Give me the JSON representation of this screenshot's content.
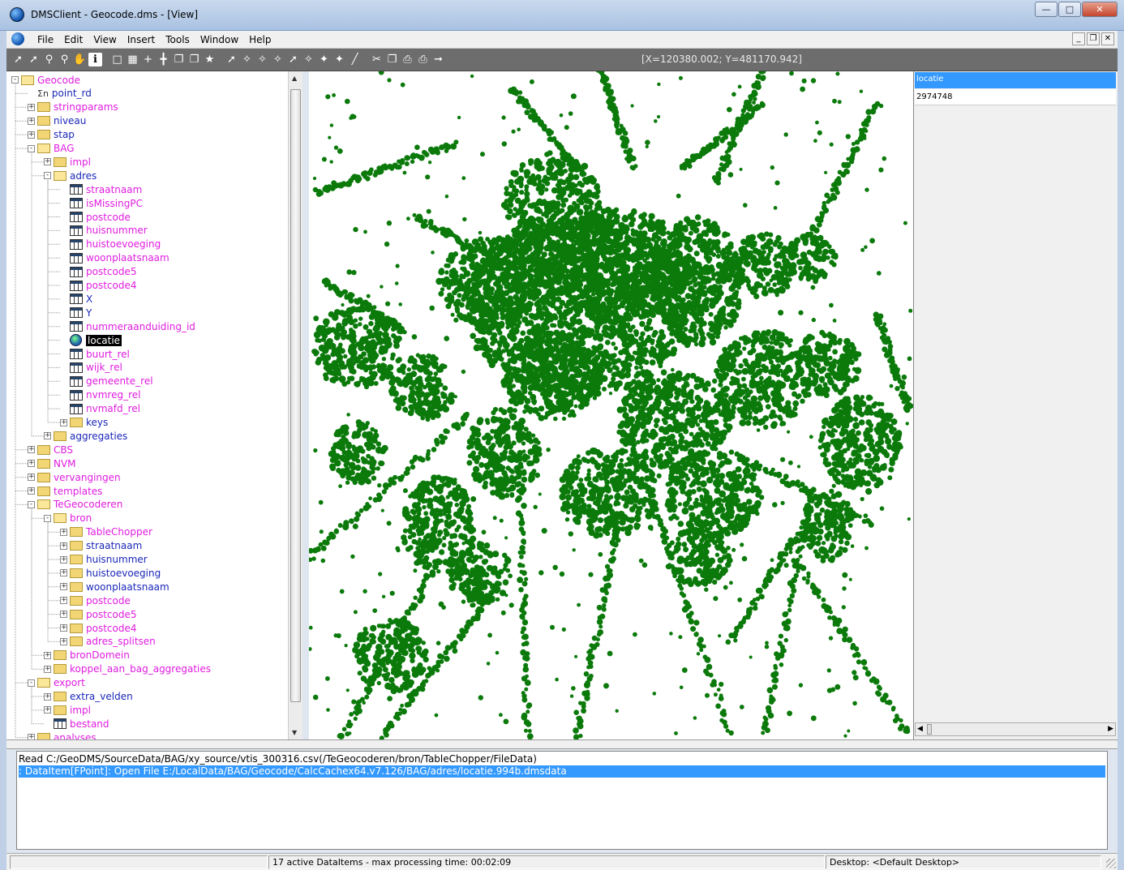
{
  "window": {
    "title": "DMSClient - Geocode.dms - [View]"
  },
  "menu": {
    "items": [
      "File",
      "Edit",
      "View",
      "Insert",
      "Tools",
      "Window",
      "Help"
    ]
  },
  "toolbar": {
    "coordinates": "[X=120380.002; Y=481170.942]"
  },
  "tree": {
    "items": [
      {
        "label": "Geocode",
        "depth": 0,
        "icon": "folder-open",
        "exp": "-",
        "color": "m"
      },
      {
        "label": "point_rd",
        "depth": 1,
        "icon": "sigma",
        "exp": "",
        "color": "b"
      },
      {
        "label": "stringparams",
        "depth": 1,
        "icon": "folder",
        "exp": "+",
        "color": "m"
      },
      {
        "label": "niveau",
        "depth": 1,
        "icon": "folder",
        "exp": "+",
        "color": "b"
      },
      {
        "label": "stap",
        "depth": 1,
        "icon": "folder",
        "exp": "+",
        "color": "b"
      },
      {
        "label": "BAG",
        "depth": 1,
        "icon": "folder-open",
        "exp": "-",
        "color": "m"
      },
      {
        "label": "impl",
        "depth": 2,
        "icon": "folder",
        "exp": "+",
        "color": "m"
      },
      {
        "label": "adres",
        "depth": 2,
        "icon": "folder-open",
        "exp": "-",
        "color": "b"
      },
      {
        "label": "straatnaam",
        "depth": 3,
        "icon": "table",
        "exp": "",
        "color": "m"
      },
      {
        "label": "isMissingPC",
        "depth": 3,
        "icon": "table",
        "exp": "",
        "color": "m"
      },
      {
        "label": "postcode",
        "depth": 3,
        "icon": "table",
        "exp": "",
        "color": "m"
      },
      {
        "label": "huisnummer",
        "depth": 3,
        "icon": "table",
        "exp": "",
        "color": "m"
      },
      {
        "label": "huistoevoeging",
        "depth": 3,
        "icon": "table",
        "exp": "",
        "color": "m"
      },
      {
        "label": "woonplaatsnaam",
        "depth": 3,
        "icon": "table",
        "exp": "",
        "color": "m"
      },
      {
        "label": "postcode5",
        "depth": 3,
        "icon": "table",
        "exp": "",
        "color": "m"
      },
      {
        "label": "postcode4",
        "depth": 3,
        "icon": "table",
        "exp": "",
        "color": "m"
      },
      {
        "label": "X",
        "depth": 3,
        "icon": "table",
        "exp": "",
        "color": "b"
      },
      {
        "label": "Y",
        "depth": 3,
        "icon": "table",
        "exp": "",
        "color": "b"
      },
      {
        "label": "nummeraanduiding_id",
        "depth": 3,
        "icon": "table",
        "exp": "",
        "color": "m"
      },
      {
        "label": "locatie",
        "depth": 3,
        "icon": "globe",
        "exp": "",
        "color": "sel"
      },
      {
        "label": "buurt_rel",
        "depth": 3,
        "icon": "table",
        "exp": "",
        "color": "m"
      },
      {
        "label": "wijk_rel",
        "depth": 3,
        "icon": "table",
        "exp": "",
        "color": "m"
      },
      {
        "label": "gemeente_rel",
        "depth": 3,
        "icon": "table",
        "exp": "",
        "color": "m"
      },
      {
        "label": "nvmreg_rel",
        "depth": 3,
        "icon": "table",
        "exp": "",
        "color": "m"
      },
      {
        "label": "nvmafd_rel",
        "depth": 3,
        "icon": "table",
        "exp": "",
        "color": "m"
      },
      {
        "label": "keys",
        "depth": 3,
        "icon": "folder",
        "exp": "+",
        "color": "b"
      },
      {
        "label": "aggregaties",
        "depth": 2,
        "icon": "folder",
        "exp": "+",
        "color": "b"
      },
      {
        "label": "CBS",
        "depth": 1,
        "icon": "folder",
        "exp": "+",
        "color": "m"
      },
      {
        "label": "NVM",
        "depth": 1,
        "icon": "folder",
        "exp": "+",
        "color": "m"
      },
      {
        "label": "vervangingen",
        "depth": 1,
        "icon": "folder",
        "exp": "+",
        "color": "m"
      },
      {
        "label": "templates",
        "depth": 1,
        "icon": "folder",
        "exp": "+",
        "color": "m"
      },
      {
        "label": "TeGeocoderen",
        "depth": 1,
        "icon": "folder-open",
        "exp": "-",
        "color": "m"
      },
      {
        "label": "bron",
        "depth": 2,
        "icon": "folder-open",
        "exp": "-",
        "color": "m"
      },
      {
        "label": "TableChopper",
        "depth": 3,
        "icon": "folder",
        "exp": "+",
        "color": "m"
      },
      {
        "label": "straatnaam",
        "depth": 3,
        "icon": "folder",
        "exp": "+",
        "color": "b"
      },
      {
        "label": "huisnummer",
        "depth": 3,
        "icon": "folder",
        "exp": "+",
        "color": "b"
      },
      {
        "label": "huistoevoeging",
        "depth": 3,
        "icon": "folder",
        "exp": "+",
        "color": "b"
      },
      {
        "label": "woonplaatsnaam",
        "depth": 3,
        "icon": "folder",
        "exp": "+",
        "color": "b"
      },
      {
        "label": "postcode",
        "depth": 3,
        "icon": "folder",
        "exp": "+",
        "color": "m"
      },
      {
        "label": "postcode5",
        "depth": 3,
        "icon": "folder",
        "exp": "+",
        "color": "m"
      },
      {
        "label": "postcode4",
        "depth": 3,
        "icon": "folder",
        "exp": "+",
        "color": "m"
      },
      {
        "label": "adres_splitsen",
        "depth": 3,
        "icon": "folder",
        "exp": "+",
        "color": "m"
      },
      {
        "label": "bronDomein",
        "depth": 2,
        "icon": "folder",
        "exp": "+",
        "color": "m"
      },
      {
        "label": "koppel_aan_bag_aggregaties",
        "depth": 2,
        "icon": "folder",
        "exp": "+",
        "color": "m"
      },
      {
        "label": "export",
        "depth": 1,
        "icon": "folder-open",
        "exp": "-",
        "color": "m"
      },
      {
        "label": "extra_velden",
        "depth": 2,
        "icon": "folder",
        "exp": "+",
        "color": "b"
      },
      {
        "label": "impl",
        "depth": 2,
        "icon": "folder",
        "exp": "+",
        "color": "m"
      },
      {
        "label": "bestand",
        "depth": 2,
        "icon": "table",
        "exp": "",
        "color": "m"
      },
      {
        "label": "analyses",
        "depth": 1,
        "icon": "folder",
        "exp": "+",
        "color": "m"
      }
    ]
  },
  "detail": {
    "header": "locatie",
    "value": "2974748"
  },
  "map": {
    "fill_color": "#0b7a0b"
  },
  "log": {
    "lines": [
      "Read C:/GeoDMS/SourceData/BAG/xy_source/vtis_300316.csv(/TeGeocoderen/bron/TableChopper/FileData)",
      ": DataItem[FPoint]: Open   File E:/LocalData/BAG/Geocode/CalcCachex64.v7.126/BAG/adres/locatie.994b.dmsdata"
    ]
  },
  "status": {
    "active": "17 active DataItems - max processing time: 00:02:09",
    "desktop": "Desktop: <Default Desktop>"
  }
}
